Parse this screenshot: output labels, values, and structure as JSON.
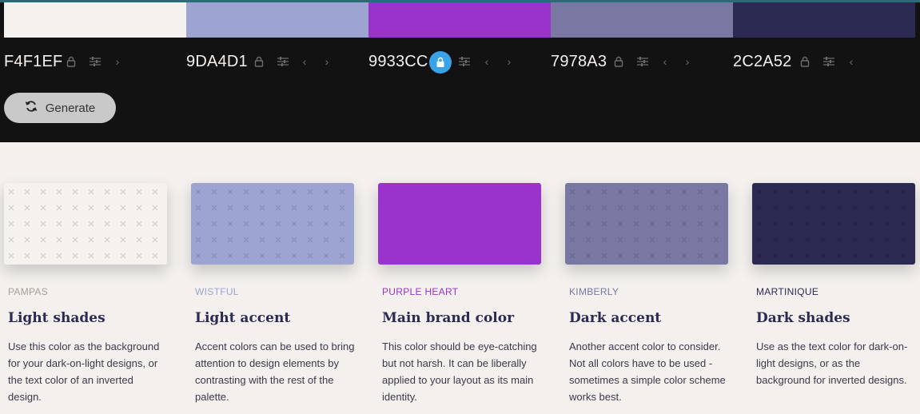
{
  "palette": [
    {
      "hex": "F4F1EF",
      "color": "#f4f1ef",
      "locked": false,
      "show_prev": false,
      "show_next": true
    },
    {
      "hex": "9DA4D1",
      "color": "#9da4d1",
      "locked": false,
      "show_prev": true,
      "show_next": true
    },
    {
      "hex": "9933CC",
      "color": "#9933cc",
      "locked": true,
      "show_prev": true,
      "show_next": true
    },
    {
      "hex": "7978A3",
      "color": "#7978a3",
      "locked": false,
      "show_prev": true,
      "show_next": true
    },
    {
      "hex": "2C2A52",
      "color": "#2c2a52",
      "locked": false,
      "show_prev": true,
      "show_next": false
    }
  ],
  "generate_label": "Generate",
  "cards": [
    {
      "name": "PAMPAS",
      "name_color": "#a89f96",
      "title": "Light shades",
      "desc": "Use this color as the background for your dark-on-light designs, or the text color of an inverted design.",
      "color": "#f4f1ef"
    },
    {
      "name": "WISTFUL",
      "name_color": "#9da4d1",
      "title": "Light accent",
      "desc": "Accent colors can be used to bring attention to design elements by contrasting with the rest of the palette.",
      "color": "#9da4d1"
    },
    {
      "name": "PURPLE HEART",
      "name_color": "#9933cc",
      "title": "Main brand color",
      "desc": "This color should be eye-catching but not harsh. It can be liberally applied to your layout as its main identity.",
      "color": "#9933cc"
    },
    {
      "name": "KIMBERLY",
      "name_color": "#7978a3",
      "title": "Dark accent",
      "desc": "Another accent color to consider. Not all colors have to be used - sometimes a simple color scheme works best.",
      "color": "#7978a3"
    },
    {
      "name": "MARTINIQUE",
      "name_color": "#2c2a52",
      "title": "Dark shades",
      "desc": "Use as the text color for dark-on-light designs, or as the background for inverted designs.",
      "color": "#2c2a52"
    }
  ]
}
